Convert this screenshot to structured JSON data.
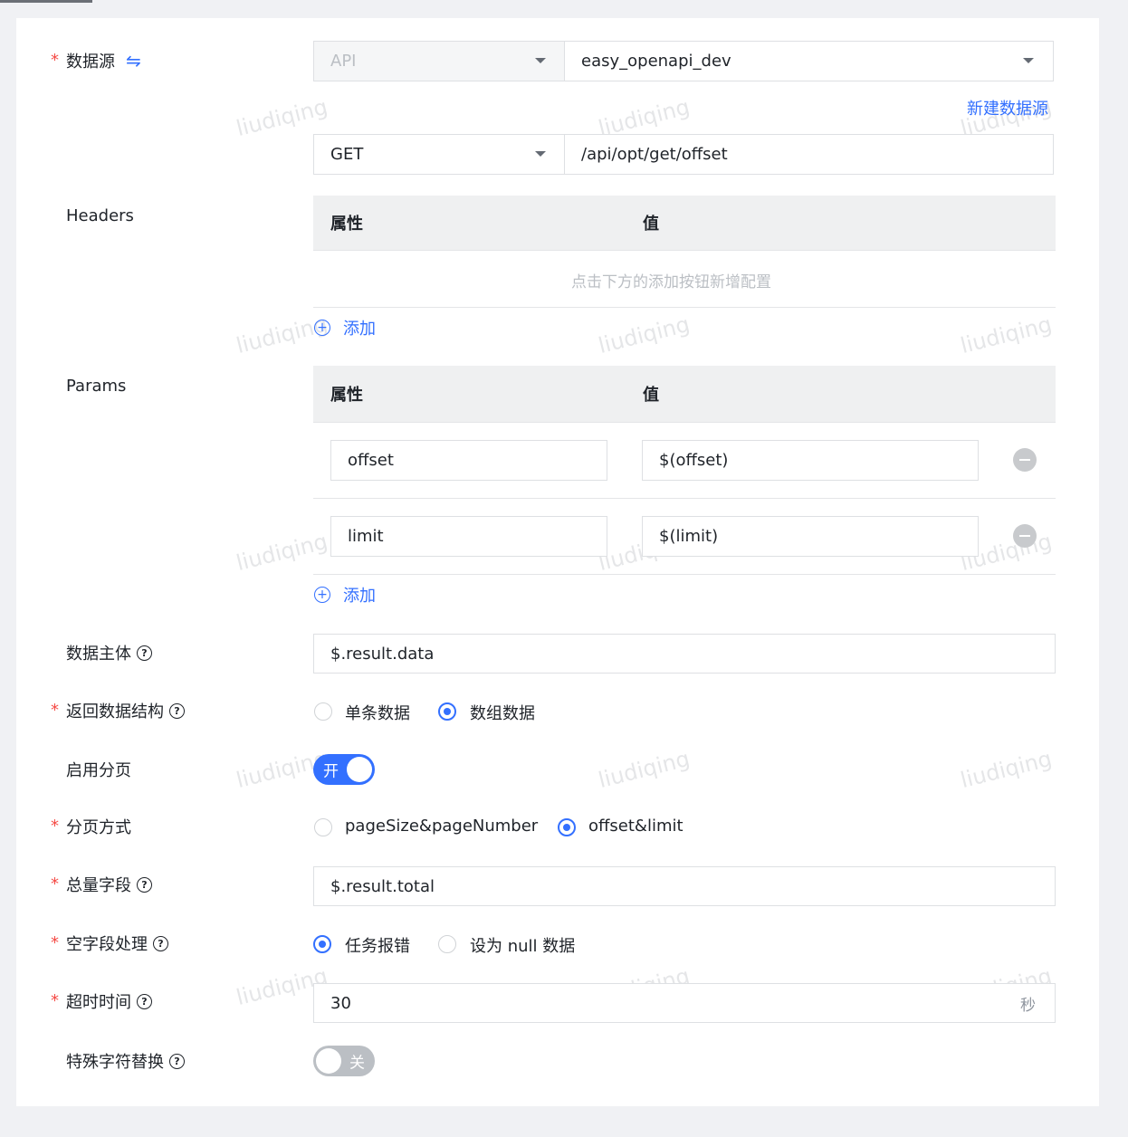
{
  "datasource": {
    "label": "数据源",
    "type_value": "API",
    "source_value": "easy_openapi_dev",
    "new_link": "新建数据源",
    "method_value": "GET",
    "path_value": "/api/opt/get/offset"
  },
  "headers": {
    "label": "Headers",
    "col_attr": "属性",
    "col_value": "值",
    "empty_text": "点击下方的添加按钮新增配置",
    "add_label": "添加"
  },
  "params": {
    "label": "Params",
    "col_attr": "属性",
    "col_value": "值",
    "rows": [
      {
        "key": "offset",
        "value": "$(offset)"
      },
      {
        "key": "limit",
        "value": "$(limit)"
      }
    ],
    "add_label": "添加"
  },
  "data_body": {
    "label": "数据主体",
    "value": "$.result.data"
  },
  "return_struct": {
    "label": "返回数据结构",
    "options": [
      "单条数据",
      "数组数据"
    ],
    "selected": 1
  },
  "paging": {
    "label": "启用分页",
    "switch_text": "开"
  },
  "paging_mode": {
    "label": "分页方式",
    "options": [
      "pageSize&pageNumber",
      "offset&limit"
    ],
    "selected": 1
  },
  "total_field": {
    "label": "总量字段",
    "value": "$.result.total"
  },
  "empty_field": {
    "label": "空字段处理",
    "options": [
      "任务报错",
      "设为 null 数据"
    ],
    "selected": 0
  },
  "timeout": {
    "label": "超时时间",
    "value": "30",
    "unit": "秒"
  },
  "special_char": {
    "label": "特殊字符替换",
    "switch_text": "关"
  },
  "watermark": "liudiqing",
  "icons": {
    "swap": "swap-icon",
    "help": "help-circle-icon",
    "plus": "plus-circle-icon",
    "minus": "minus-circle-icon"
  },
  "colors": {
    "primary": "#3370ff",
    "required": "#f54a45"
  }
}
